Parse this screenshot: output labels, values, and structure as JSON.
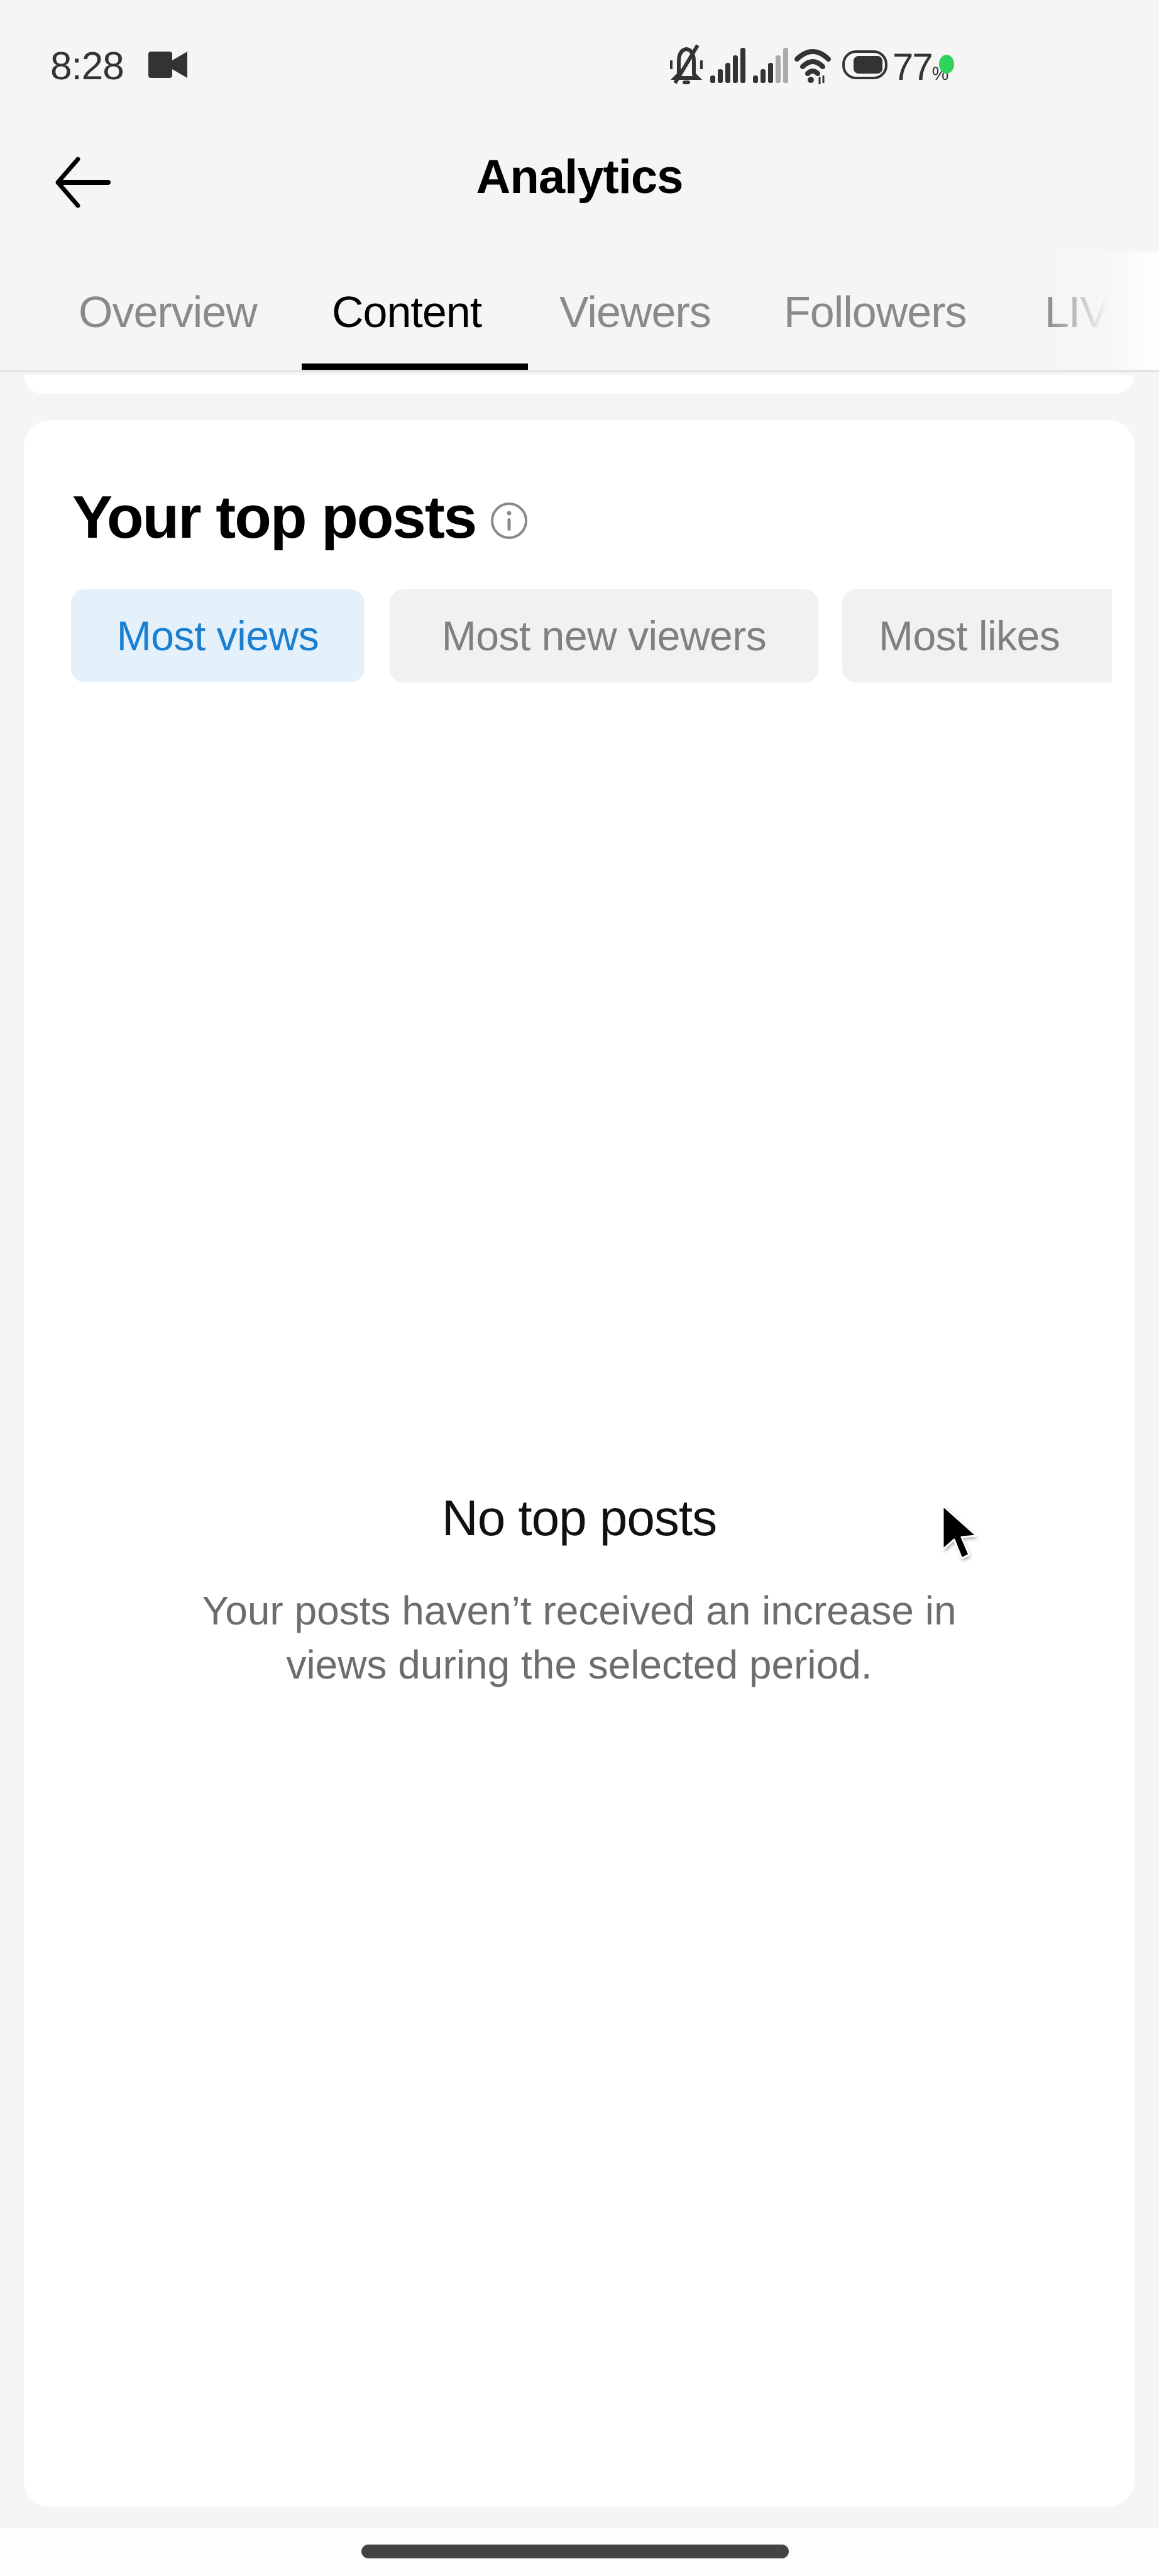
{
  "status_bar": {
    "time": "8:28",
    "battery_percent": "77",
    "battery_symbol": "%",
    "icons": [
      "video-recording-icon",
      "mute-bell-icon",
      "signal-sim1-icon",
      "signal-sim2-icon",
      "wifi-icon",
      "battery-icon",
      "privacy-indicator-dot"
    ],
    "privacy_dot_color": "#2fd35c"
  },
  "header": {
    "back_icon": "arrow-left-icon",
    "title": "Analytics"
  },
  "tabs": {
    "items": [
      {
        "label": "Overview",
        "active": false
      },
      {
        "label": "Content",
        "active": true
      },
      {
        "label": "Viewers",
        "active": false
      },
      {
        "label": "Followers",
        "active": false
      },
      {
        "label": "LIVE",
        "active": false
      }
    ]
  },
  "top_posts": {
    "title": "Your top posts",
    "info_icon": "info-circle-icon",
    "filters": [
      {
        "label": "Most views",
        "active": true
      },
      {
        "label": "Most new viewers",
        "active": false
      },
      {
        "label": "Most likes",
        "active": false
      }
    ],
    "empty_state": {
      "title": "No top posts",
      "description_line1": "Your posts haven’t received an increase in",
      "description_line2": "views during the selected period."
    }
  },
  "colors": {
    "accent_blue": "#1a7fd0",
    "active_chip_bg": "#e4f1fb",
    "inactive_chip_bg": "#f1f1f1",
    "inactive_text": "#8a8a8a",
    "page_bg": "#f5f5f5"
  }
}
